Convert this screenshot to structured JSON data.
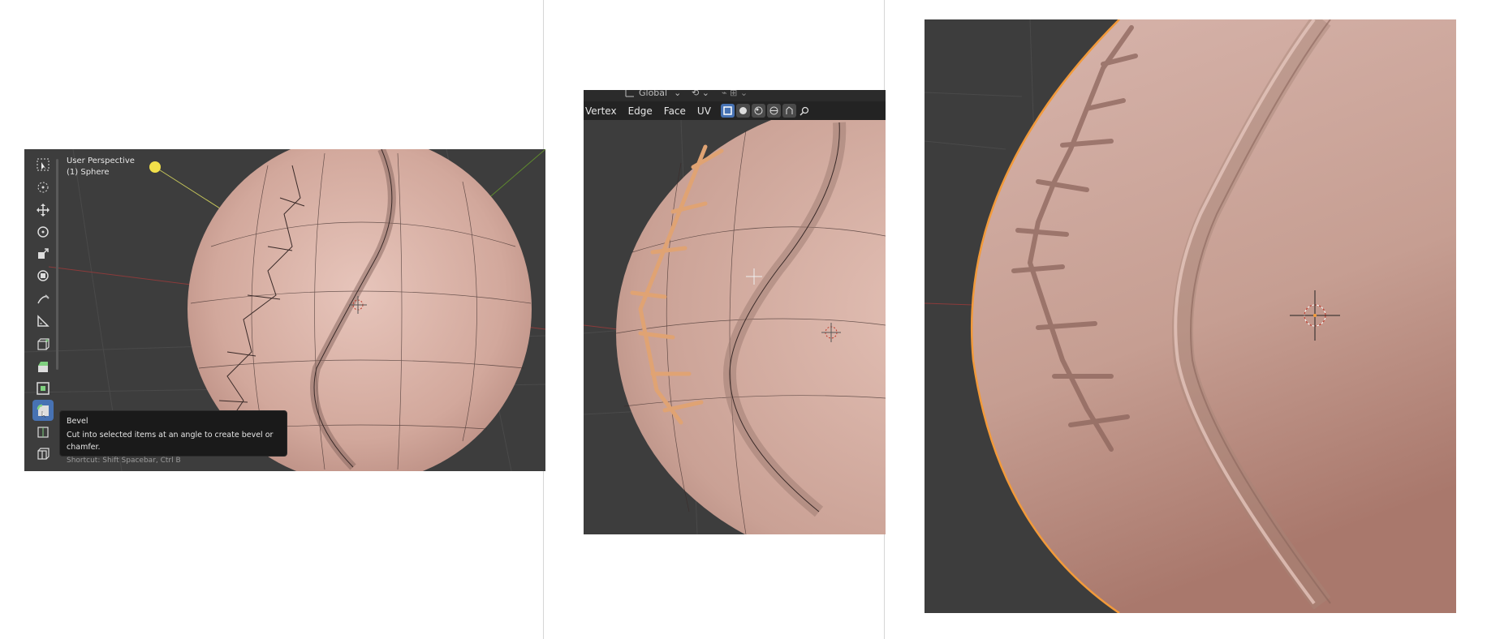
{
  "panel_a": {
    "viewport": {
      "perspective_label": "User Perspective",
      "object_label": "(1) Sphere"
    },
    "toolbar": {
      "tools": [
        {
          "name": "select-box",
          "icon": "select-box-icon"
        },
        {
          "name": "cursor",
          "icon": "cursor-icon"
        },
        {
          "name": "move",
          "icon": "move-icon"
        },
        {
          "name": "rotate",
          "icon": "rotate-icon"
        },
        {
          "name": "scale",
          "icon": "scale-icon"
        },
        {
          "name": "transform",
          "icon": "transform-icon"
        },
        {
          "name": "annotate",
          "icon": "annotate-icon"
        },
        {
          "name": "measure",
          "icon": "measure-icon"
        },
        {
          "name": "add-cube",
          "icon": "add-cube-icon"
        },
        {
          "name": "extrude-region",
          "icon": "extrude-icon"
        },
        {
          "name": "inset-faces",
          "icon": "inset-icon"
        },
        {
          "name": "bevel",
          "icon": "bevel-icon",
          "active": true
        },
        {
          "name": "loop-cut",
          "icon": "loop-cut-icon"
        },
        {
          "name": "knife",
          "icon": "knife-icon"
        }
      ]
    },
    "tooltip": {
      "title": "Bevel",
      "description": "Cut into selected items at an angle to create bevel or chamfer.",
      "shortcut": "Shortcut: Shift Spacebar, Ctrl B"
    }
  },
  "panel_b": {
    "header_top": {
      "transform_orientation": "Global"
    },
    "header": {
      "menu": [
        "Vertex",
        "Edge",
        "Face",
        "UV"
      ]
    },
    "shading_buttons": [
      "solid-shading-icon",
      "material-shading-icon",
      "rendered-shading-icon",
      "overlay-icon",
      "xray-icon",
      "search-icon"
    ]
  },
  "colors": {
    "viewport_bg": "#3d3d3d",
    "mesh_skin": "#d9b1a6",
    "active_tool": "#4772b3",
    "selection_outline": "#f29a3a",
    "light_yellow": "#f2e04a"
  }
}
